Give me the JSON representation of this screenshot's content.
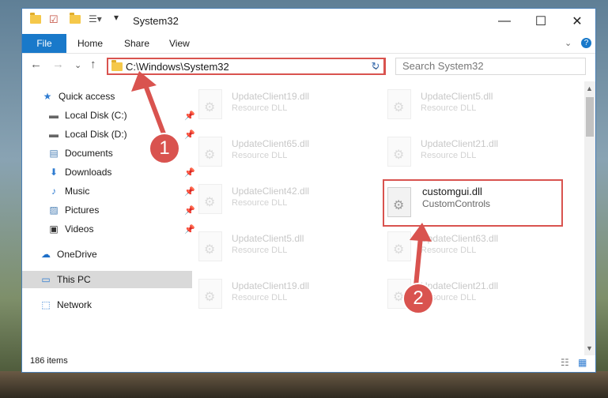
{
  "window": {
    "title": "System32",
    "controls": {
      "minimize": "—",
      "maximize": "☐",
      "close": "✕"
    }
  },
  "ribbon": {
    "tabs": [
      "File",
      "Home",
      "Share",
      "View"
    ],
    "help": "?"
  },
  "address": {
    "path": "C:\\Windows\\System32",
    "dropdown": "⌄",
    "refresh": "↻"
  },
  "search": {
    "placeholder": "Search System32"
  },
  "nav": {
    "back": "←",
    "forward": "→",
    "recent": "⌄",
    "up": "↑"
  },
  "sidebar": {
    "items": [
      {
        "label": "Quick access",
        "icon": "star-icon",
        "pinned": false
      },
      {
        "label": "Local Disk (C:)",
        "icon": "drive-icon",
        "pinned": true
      },
      {
        "label": "Local Disk (D:)",
        "icon": "drive-icon",
        "pinned": true
      },
      {
        "label": "Documents",
        "icon": "documents-icon",
        "pinned": false
      },
      {
        "label": "Downloads",
        "icon": "download-icon",
        "pinned": true
      },
      {
        "label": "Music",
        "icon": "music-icon",
        "pinned": true
      },
      {
        "label": "Pictures",
        "icon": "pictures-icon",
        "pinned": true
      },
      {
        "label": "Videos",
        "icon": "videos-icon",
        "pinned": true
      },
      {
        "label": "OneDrive",
        "icon": "cloud-icon",
        "pinned": false
      },
      {
        "label": "This PC",
        "icon": "computer-icon",
        "pinned": false
      },
      {
        "label": "Network",
        "icon": "network-icon",
        "pinned": false
      }
    ]
  },
  "files": [
    {
      "name": "UpdateClient19.dll",
      "type": "Resource DLL"
    },
    {
      "name": "UpdateClient5.dll",
      "type": "Resource DLL"
    },
    {
      "name": "UpdateClient65.dll",
      "type": "Resource DLL"
    },
    {
      "name": "UpdateClient21.dll",
      "type": "Resource DLL"
    },
    {
      "name": "UpdateClient42.dll",
      "type": "Resource DLL"
    },
    {
      "name": "customgui.dll",
      "type": "CustomControls"
    },
    {
      "name": "UpdateClient5.dll",
      "type": "Resource DLL"
    },
    {
      "name": "UpdateClient63.dll",
      "type": "Resource DLL"
    },
    {
      "name": "UpdateClient19.dll",
      "type": "Resource DLL"
    },
    {
      "name": "UpdateClient21.dll",
      "type": "Resource DLL"
    }
  ],
  "status": {
    "count": "186 items"
  },
  "annotations": {
    "step1": "1",
    "step2": "2"
  },
  "colors": {
    "accent": "#1979ca",
    "highlight": "#d9534f"
  }
}
